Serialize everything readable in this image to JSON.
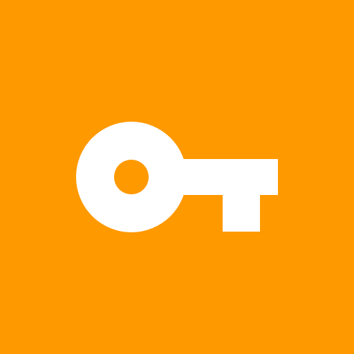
{
  "icon": {
    "name": "key-icon",
    "background_color": "#FF9900",
    "glyph_color": "#FFFFFF"
  }
}
